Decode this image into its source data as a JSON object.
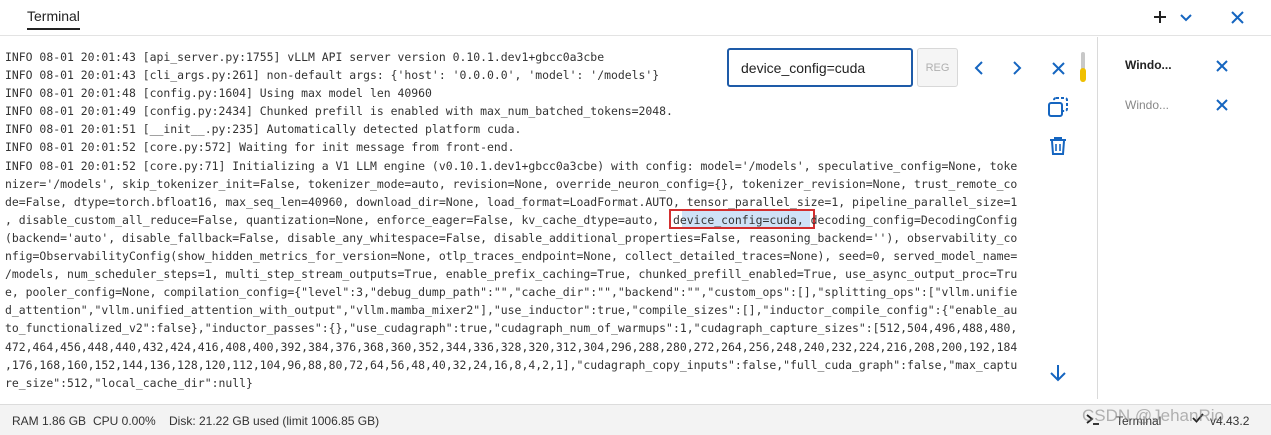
{
  "tabs": [
    {
      "label": "Terminal"
    }
  ],
  "topbar": {
    "icons": [
      "plus-icon",
      "chevron-down-icon",
      "close-icon"
    ]
  },
  "terminal": {
    "lines": [
      "INFO 08-01 20:01:43 [api_server.py:1755] vLLM API server version 0.10.1.dev1+gbcc0a3cbe",
      "INFO 08-01 20:01:43 [cli_args.py:261] non-default args: {'host': '0.0.0.0', 'model': '/models'}",
      "INFO 08-01 20:01:48 [config.py:1604] Using max model len 40960",
      "INFO 08-01 20:01:49 [config.py:2434] Chunked prefill is enabled with max_num_batched_tokens=2048.",
      "INFO 08-01 20:01:51 [__init__.py:235] Automatically detected platform cuda.",
      "INFO 08-01 20:01:52 [core.py:572] Waiting for init message from front-end.",
      "INFO 08-01 20:01:52 [core.py:71] Initializing a V1 LLM engine (v0.10.1.dev1+gbcc0a3cbe) with config: model='/models', speculative_config=None, toke",
      "nizer='/models', skip_tokenizer_init=False, tokenizer_mode=auto, revision=None, override_neuron_config={}, tokenizer_revision=None, trust_remote_co",
      "de=False, dtype=torch.bfloat16, max_seq_len=40960, download_dir=None, load_format=LoadFormat.AUTO, tensor_parallel_size=1, pipeline_parallel_size=1",
      ", disable_custom_all_reduce=False, quantization=None, enforce_eager=False, kv_cache_dtype=auto,  device_config=cuda, decoding_config=DecodingConfig",
      "(backend='auto', disable_fallback=False, disable_any_whitespace=False, disable_additional_properties=False, reasoning_backend=''), observability_co",
      "nfig=ObservabilityConfig(show_hidden_metrics_for_version=None, otlp_traces_endpoint=None, collect_detailed_traces=None), seed=0, served_model_name=",
      "/models, num_scheduler_steps=1, multi_step_stream_outputs=True, enable_prefix_caching=True, chunked_prefill_enabled=True, use_async_output_proc=Tru",
      "e, pooler_config=None, compilation_config={\"level\":3,\"debug_dump_path\":\"\",\"cache_dir\":\"\",\"backend\":\"\",\"custom_ops\":[],\"splitting_ops\":[\"vllm.unifie",
      "d_attention\",\"vllm.unified_attention_with_output\",\"vllm.mamba_mixer2\"],\"use_inductor\":true,\"compile_sizes\":[],\"inductor_compile_config\":{\"enable_au",
      "to_functionalized_v2\":false},\"inductor_passes\":{},\"use_cudagraph\":true,\"cudagraph_num_of_warmups\":1,\"cudagraph_capture_sizes\":[512,504,496,488,480,",
      "472,464,456,448,440,432,424,416,408,400,392,384,376,368,360,352,344,336,328,320,312,304,296,288,280,272,264,256,248,240,232,224,216,208,200,192,184",
      ",176,168,160,152,144,136,128,120,112,104,96,88,80,72,64,56,48,40,32,24,16,8,4,2,1],\"cudagraph_copy_inputs\":false,\"full_cuda_graph\":false,\"max_captu",
      "re_size\":512,\"local_cache_dir\":null}"
    ]
  },
  "find": {
    "value": "device_config=cuda",
    "regex_label": "REG",
    "icons": [
      "chevron-left-icon",
      "chevron-right-icon",
      "close-icon"
    ]
  },
  "side_actions": [
    "copy-icon",
    "trash-icon",
    "arrow-down-icon"
  ],
  "windows": [
    {
      "label": "Windo...",
      "active": true
    },
    {
      "label": "Windo...",
      "active": false
    }
  ],
  "status": {
    "ram": "RAM 1.86 GB",
    "cpu": "CPU 0.00%",
    "disk": "Disk: 21.22 GB used (limit 1006.85 GB)",
    "terminal": "Terminal",
    "version": "v4.43.2",
    "watermark": "CSDN @JehanRio"
  },
  "colors": {
    "accent": "#1565c0",
    "highlight_border": "#d32f2f",
    "match_bg": "#cfe2f7"
  }
}
